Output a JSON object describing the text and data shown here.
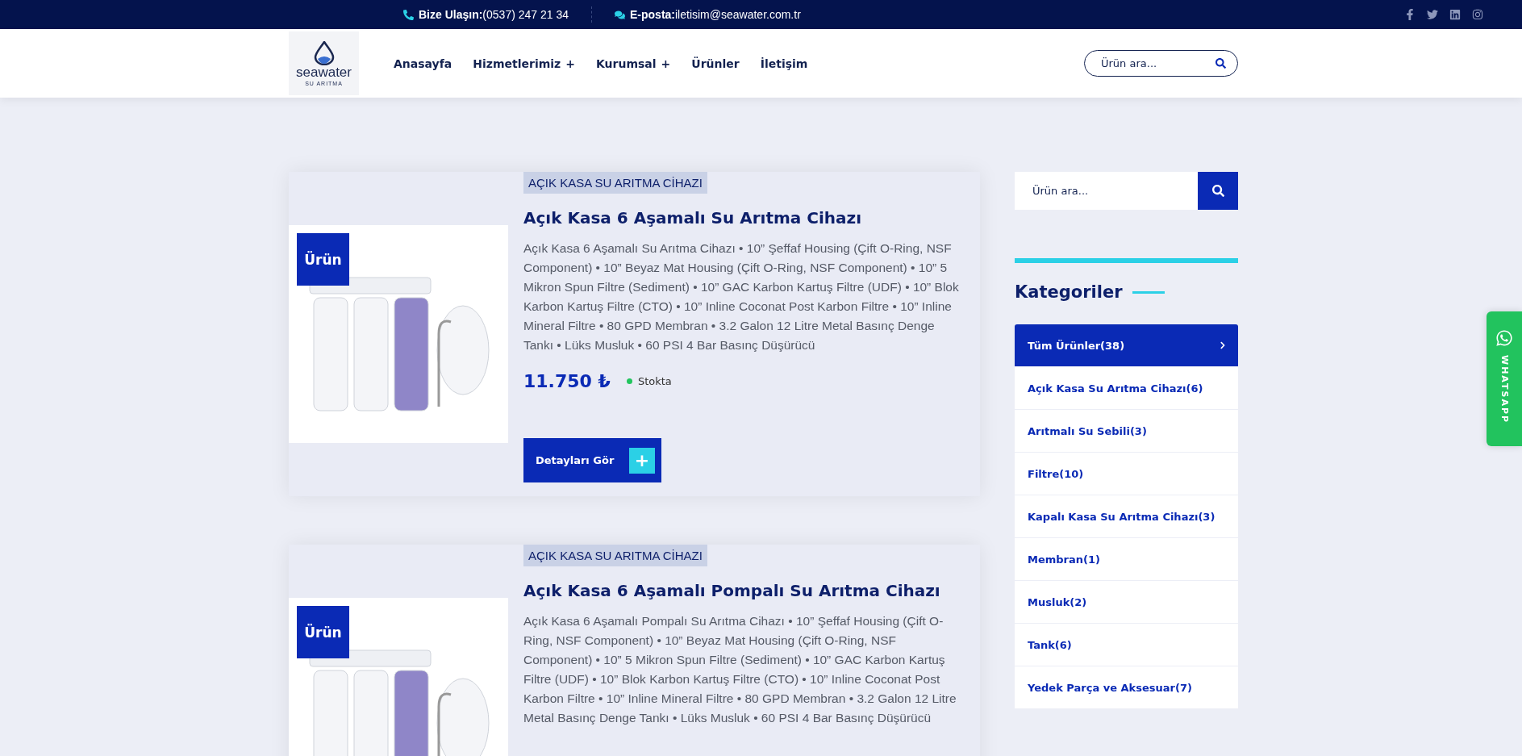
{
  "top_bar": {
    "phone_label": "Bize Ulaşın:",
    "phone": "(0537) 247 21 34",
    "email_label": "E-posta:",
    "email": "iletisim@seawater.com.tr"
  },
  "header": {
    "logo_text": "seawater",
    "logo_subtext": "SU ARITMA",
    "nav": [
      {
        "label": "Anasayfa",
        "has_submenu": false
      },
      {
        "label": "Hizmetlerimiz",
        "has_submenu": true
      },
      {
        "label": "Kurumsal",
        "has_submenu": true
      },
      {
        "label": "Ürünler",
        "has_submenu": false
      },
      {
        "label": "İletişim",
        "has_submenu": false
      }
    ],
    "submenu_mark": "+",
    "search": {
      "placeholder": "Ürün ara..."
    }
  },
  "products": [
    {
      "category": "AÇIK KASA SU ARITMA CİHAZI",
      "badge": "Ürün",
      "title": "Açık Kasa 6 Aşamalı Su Arıtma Cihazı",
      "description": "Açık Kasa 6 Aşamalı Su Arıtma Cihazı • 10” Şeffaf Housing (Çift O-Ring, NSF Component) • 10” Beyaz Mat Housing (Çift O-Ring, NSF Component) • 10” 5 Mikron Spun Filtre (Sediment) • 10” GAC Karbon Kartuş Filtre (UDF) • 10” Blok Karbon Kartuş Filtre (CTO) • 10” Inline Coconat Post Karbon Filtre • 10” Inline Mineral Filtre • 80 GPD Membran • 3.2 Galon 12 Litre Metal Basınç Denge Tankı • Lüks Musluk • 60 PSI 4 Bar Basınç Düşürücü",
      "price": "11.750 ₺",
      "stock": "Stokta",
      "button": "Detayları Gör",
      "button_mark": "+"
    },
    {
      "category": "AÇIK KASA SU ARITMA CİHAZI",
      "badge": "Ürün",
      "title": "Açık Kasa 6 Aşamalı Pompalı Su Arıtma Cihazı",
      "description": "Açık Kasa 6 Aşamalı Pompalı Su Arıtma Cihazı • 10” Şeffaf Housing (Çift O-Ring, NSF Component) • 10” Beyaz Mat Housing (Çift O-Ring, NSF Component) • 10” 5 Mikron Spun Filtre (Sediment) • 10” GAC Karbon Kartuş Filtre (UDF) • 10” Blok Karbon Kartuş Filtre (CTO) • 10” Inline Coconat Post Karbon Filtre • 10” Inline Mineral Filtre • 80 GPD Membran • 3.2 Galon 12 Litre Metal Basınç Denge Tankı • Lüks Musluk • 60 PSI 4 Bar Basınç Düşürücü"
    }
  ],
  "sidebar": {
    "search": {
      "placeholder": "Ürün ara..."
    },
    "categories_title": "Kategoriler",
    "categories": [
      {
        "label": "Tüm Ürünler(38)",
        "selected": true
      },
      {
        "label": "Açık Kasa Su Arıtma Cihazı(6)",
        "selected": false
      },
      {
        "label": "Arıtmalı Su Sebili(3)",
        "selected": false
      },
      {
        "label": "Filtre(10)",
        "selected": false
      },
      {
        "label": "Kapalı Kasa Su Arıtma Cihazı(3)",
        "selected": false
      },
      {
        "label": "Membran(1)",
        "selected": false
      },
      {
        "label": "Musluk(2)",
        "selected": false
      },
      {
        "label": "Tank(6)",
        "selected": false
      },
      {
        "label": "Yedek Parça ve Aksesuar(7)",
        "selected": false
      }
    ]
  },
  "whatsapp": {
    "label": "WHATSAPP"
  }
}
